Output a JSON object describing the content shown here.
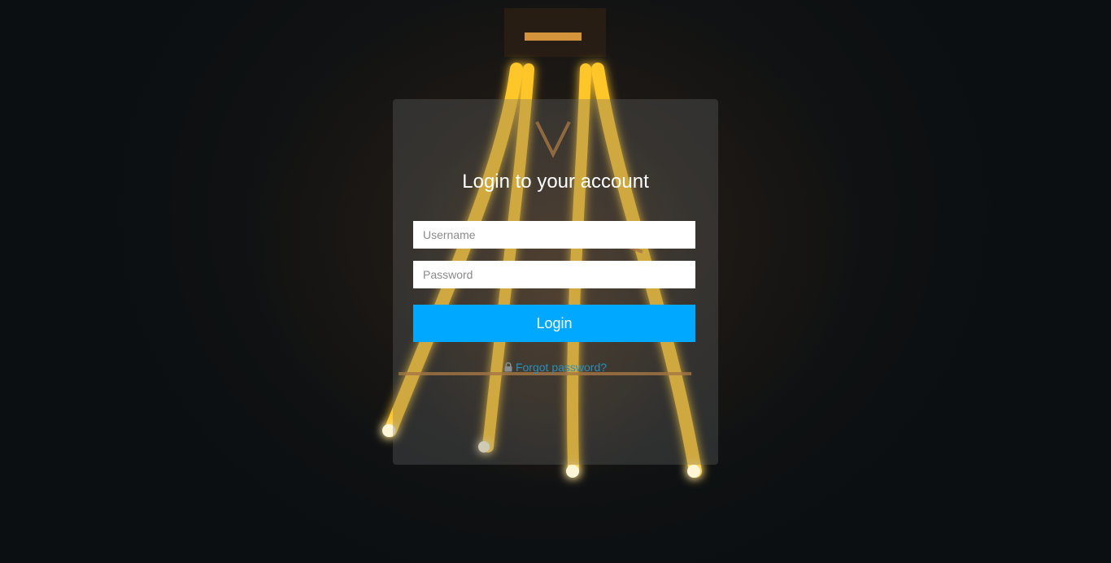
{
  "login": {
    "title": "Login to your account",
    "username_placeholder": "Username",
    "password_placeholder": "Password",
    "submit_label": "Login",
    "forgot_label": "Forgot password?",
    "forgot_icon": "lock-icon"
  },
  "colors": {
    "accent": "#00a8ff",
    "link": "#2a8fb8",
    "background": "#0b0f12"
  }
}
